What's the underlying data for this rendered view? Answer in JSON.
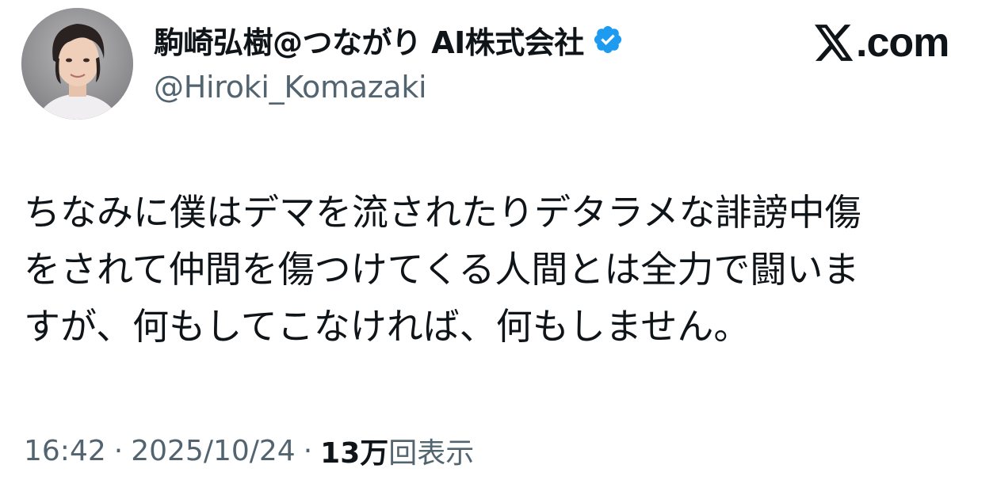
{
  "author": {
    "display_name": "駒崎弘樹@つながり AI株式会社",
    "handle": "@Hiroki_Komazaki",
    "verified": true,
    "avatar": "profile-photo"
  },
  "brand": {
    "logo_text": ".com",
    "logo_icon": "x-logo-icon"
  },
  "tweet": {
    "lines": [
      "ちなみに僕はデマを流されたりデタラメな誹謗中傷",
      "をされて仲間を傷つけてくる人間とは全力で闘いま",
      "すが、何もしてこなければ、何もしません。"
    ]
  },
  "meta": {
    "time": "16:42",
    "separator": "·",
    "date": "2025/10/24",
    "views_count": "13万",
    "views_label": "回表示"
  },
  "colors": {
    "text": "#0f1419",
    "secondary": "#536471",
    "verified_blue": "#1d9bf0"
  }
}
